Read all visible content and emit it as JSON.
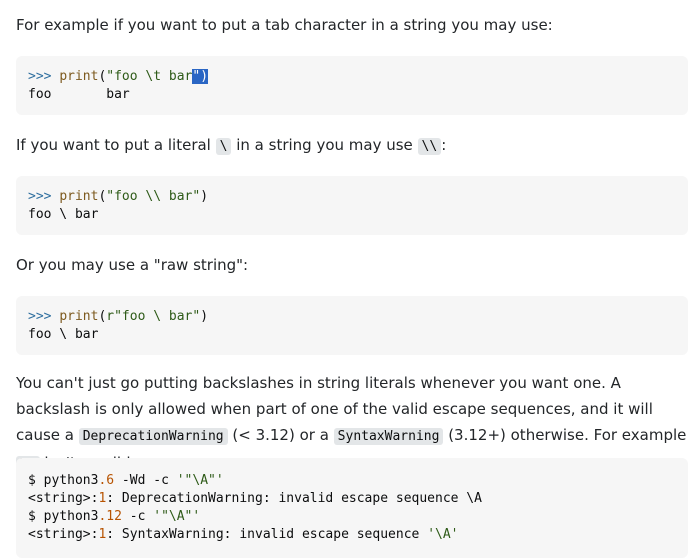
{
  "p1": {
    "text": "For example if you want to put a tab character in a string you may use:"
  },
  "c1": {
    "line1": {
      "prompt": ">>> ",
      "fn": "print",
      "paren": "(",
      "str": "\"foo \\t bar",
      "sel": "\")"
    },
    "line2": "foo       bar"
  },
  "p2": {
    "before": "If you want to put a literal ",
    "code1": "\\",
    "mid": " in a string you may use ",
    "code2": "\\\\",
    "after": ":"
  },
  "c2": {
    "line1": {
      "prompt": ">>> ",
      "fn": "print",
      "paren": "(",
      "str": "\"foo \\\\ bar\"",
      "close": ")"
    },
    "line2": "foo \\ bar"
  },
  "p3": {
    "text": "Or you may use a \"raw string\":"
  },
  "c3": {
    "line1": {
      "prompt": ">>> ",
      "fn": "print",
      "paren": "(",
      "str": "r\"foo \\ bar\"",
      "close": ")"
    },
    "line2": "foo \\ bar"
  },
  "p4": {
    "t1": "You can't just go putting backslashes in string literals whenever you want one. A backslash is only allowed when part of one of the valid escape sequences, and it will cause a ",
    "code1": "DeprecationWarning",
    "t2": " (< 3.12) or a ",
    "code2": "SyntaxWarning",
    "t3": " (3.12+) otherwise. For example ",
    "code3": "\\A",
    "t4": " isn't a valid escape sequence:"
  },
  "c4": {
    "l1": {
      "a": "$ python3",
      "num": ".6",
      "b": " -Wd -c ",
      "str": "'\"\\A\"'"
    },
    "l2": {
      "a": "<string>:",
      "num": "1",
      "b": ": DeprecationWarning: invalid escape sequence \\A"
    },
    "l3": {
      "a": "$ python3",
      "num": ".12",
      "b": " -c ",
      "str": "'\"\\A\"'"
    },
    "l4": {
      "a": "<string>:",
      "num": "1",
      "b": ": SyntaxWarning: invalid escape sequence ",
      "str": "'\\A'"
    }
  }
}
